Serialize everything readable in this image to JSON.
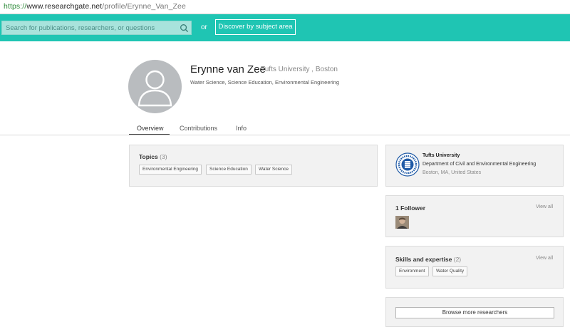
{
  "browser": {
    "url_scheme": "https://",
    "url_host": "www.researchgate.net",
    "url_path": "/profile/Erynne_Van_Zee"
  },
  "header": {
    "search_placeholder": "Search for publications, researchers, or questions",
    "or_label": "or",
    "discover_label": "Discover by subject area",
    "bar_color": "#1fc5b3"
  },
  "profile": {
    "name": "Erynne van Zee",
    "institution": "Tufts University , Boston",
    "disciplines": "Water Science, Science Education, Environmental Engineering"
  },
  "tabs": [
    {
      "label": "Overview",
      "active": true
    },
    {
      "label": "Contributions",
      "active": false
    },
    {
      "label": "Info",
      "active": false
    }
  ],
  "topics": {
    "title": "Topics",
    "count": "(3)",
    "items": [
      "Environmental Engineering",
      "Science Education",
      "Water Science"
    ]
  },
  "affiliation": {
    "university": "Tufts University",
    "department": "Department of Civil and Environmental Engineering",
    "location": "Boston, MA, United States",
    "logo_icon": "university-seal-icon"
  },
  "followers": {
    "title": "1 Follower",
    "view_all": "View all"
  },
  "skills": {
    "title": "Skills and expertise",
    "count": "(2)",
    "view_all": "View all",
    "items": [
      "Environment",
      "Water Quality"
    ]
  },
  "browse": {
    "label": "Browse more researchers"
  }
}
